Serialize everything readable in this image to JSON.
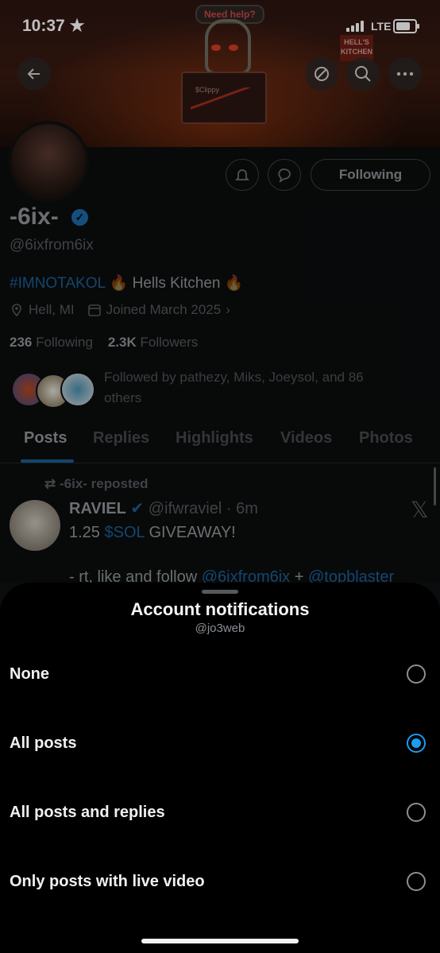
{
  "status_bar": {
    "time": "10:37",
    "network": "LTE"
  },
  "banner": {
    "help_text": "Need help?",
    "sign_text": "HELL'S KITCHEN",
    "monitor_text": "$Clippy"
  },
  "header": {
    "back_icon": "back-arrow-icon",
    "icons": [
      "stop-icon",
      "search-icon",
      "more-icon"
    ]
  },
  "profile": {
    "name": "-6ix-",
    "handle": "@6ixfrom6ix",
    "bio_hashtag": "#IMNOTAKOL",
    "bio_text": "Hells Kitchen",
    "fire": "🔥",
    "location": "Hell, MI",
    "joined": "Joined March 2025",
    "following_count": "236",
    "following_label": "Following",
    "followers_count": "2.3K",
    "followers_label": "Followers",
    "followed_by_line1": "Followed by pathezy, Miks, Joeysol, and 86",
    "followed_by_line2": "others",
    "following_button": "Following"
  },
  "tabs": [
    "Posts",
    "Replies",
    "Highlights",
    "Videos",
    "Photos"
  ],
  "post": {
    "repost_label": "-6ix- reposted",
    "author": "RAVIEL",
    "handle": "@ifwraviel",
    "time": "· 6m",
    "line1_prefix": "1.25 ",
    "line1_link": "$SOL",
    "line1_suffix": " GIVEAWAY!",
    "line2_prefix": "- rt, like and follow ",
    "line2_link1": "@6ixfrom6ix",
    "line2_plus": " + ",
    "line2_link2": "@topblaster"
  },
  "sheet": {
    "title": "Account notifications",
    "subtitle": "@jo3web",
    "options": [
      {
        "label": "None",
        "selected": false
      },
      {
        "label": "All posts",
        "selected": true
      },
      {
        "label": "All posts and replies",
        "selected": false
      },
      {
        "label": "Only posts with live video",
        "selected": false
      }
    ]
  },
  "colors": {
    "accent": "#1d9bf0",
    "sheet_bg": "#000000"
  }
}
